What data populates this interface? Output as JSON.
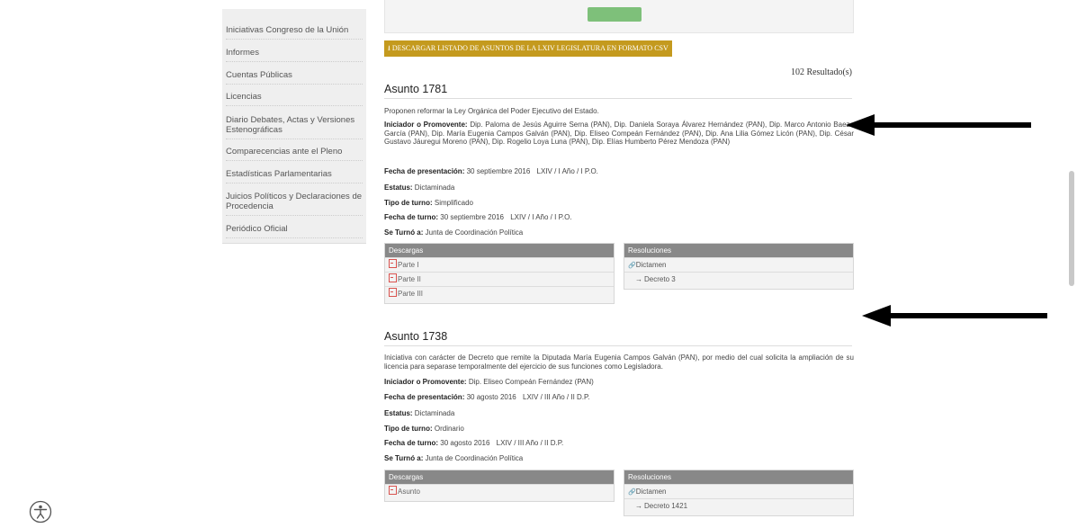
{
  "bookmarks_bar": {
    "items": [
      "",
      "",
      "",
      "",
      "",
      "",
      "",
      "",
      "",
      "",
      "",
      "",
      "",
      "",
      "",
      ""
    ]
  },
  "sidebar": {
    "items": [
      {
        "label": "Iniciativas Congreso de la Unión"
      },
      {
        "label": "Informes"
      },
      {
        "label": "Cuentas Públicas"
      },
      {
        "label": "Licencias"
      },
      {
        "label": "Diario Debates, Actas y Versiones Estenográficas"
      },
      {
        "label": "Comparecencias ante el Pleno"
      },
      {
        "label": "Estadísticas Parlamentarias"
      },
      {
        "label": "Juicios Políticos y Declaraciones de Procedencia"
      },
      {
        "label": "Periódico Oficial"
      }
    ]
  },
  "csv_button": {
    "label": "DESCARGAR LISTADO DE ASUNTOS DE LA LXIV LEGISLATURA EN FORMATO CSV"
  },
  "results": {
    "count_text": "102 Resultado(s)"
  },
  "labels": {
    "iniciador": "Iniciador o Promovente:",
    "fecha_presentacion": "Fecha de presentación:",
    "estatus": "Estatus:",
    "tipo_turno": "Tipo de turno:",
    "fecha_turno": "Fecha de turno:",
    "se_turno": "Se Turnó a:",
    "descargas": "Descargas",
    "resoluciones": "Resoluciones"
  },
  "asuntos": [
    {
      "title": "Asunto 1781",
      "description": "Proponen reformar la Ley Orgánica del Poder Ejecutivo del Estado.",
      "iniciador": "Dip. Paloma de Jesús Aguirre Serna (PAN), Dip. Daniela Soraya Álvarez Hernández (PAN), Dip. Marco Antonio Baeza García (PAN), Dip. María Eugenia Campos Galván (PAN), Dip. Eliseo Compeán Fernández (PAN), Dip. Ana Lilia Gómez Licón (PAN), Dip. César Gustavo Jáuregui Moreno (PAN), Dip. Rogelio Loya Luna (PAN), Dip. Elías Humberto Pérez Mendoza (PAN)",
      "fecha_presentacion": "30 septiembre 2016",
      "fecha_presentacion_periodo": "LXIV / I Año / I P.O.",
      "estatus": "Dictaminada",
      "tipo_turno": "Simplificado",
      "fecha_turno": "30 septiembre 2016",
      "fecha_turno_periodo": "LXIV / I Año / I P.O.",
      "se_turno": "Junta de Coordinación Política",
      "descargas": [
        "Parte I",
        "Parte II",
        "Parte III"
      ],
      "resoluciones": {
        "dictamen": "Dictamen",
        "decreto": "Decreto 3"
      }
    },
    {
      "title": "Asunto 1738",
      "description": "Iniciativa con carácter de Decreto que remite la Diputada María Eugenia Campos Galván (PAN), por medio del cual solicita la ampliación de su licencia para separase temporalmente del ejercicio de sus funciones como Legisladora.",
      "iniciador": "Dip. Eliseo Compeán Fernández (PAN)",
      "fecha_presentacion": "30 agosto 2016",
      "fecha_presentacion_periodo": "LXIV / III Año / II D.P.",
      "estatus": "Dictaminada",
      "tipo_turno": "Ordinario",
      "fecha_turno": "30 agosto 2016",
      "fecha_turno_periodo": "LXIV / III Año / II D.P.",
      "se_turno": "Junta de Coordinación Política",
      "descargas": [
        "Asunto"
      ],
      "resoluciones": {
        "dictamen": "Dictamen",
        "decreto": "Decreto 1421"
      }
    }
  ],
  "icons": {
    "download": "download-icon",
    "pdf": "pdf-icon",
    "link": "link-icon",
    "arrow": "arrow-right-icon",
    "accessibility": "accessibility-icon"
  },
  "colors": {
    "csv_button": "#c49a1e",
    "panel_header": "#888888",
    "pdf": "#d9534f",
    "sidebar_bg": "#efefef"
  }
}
